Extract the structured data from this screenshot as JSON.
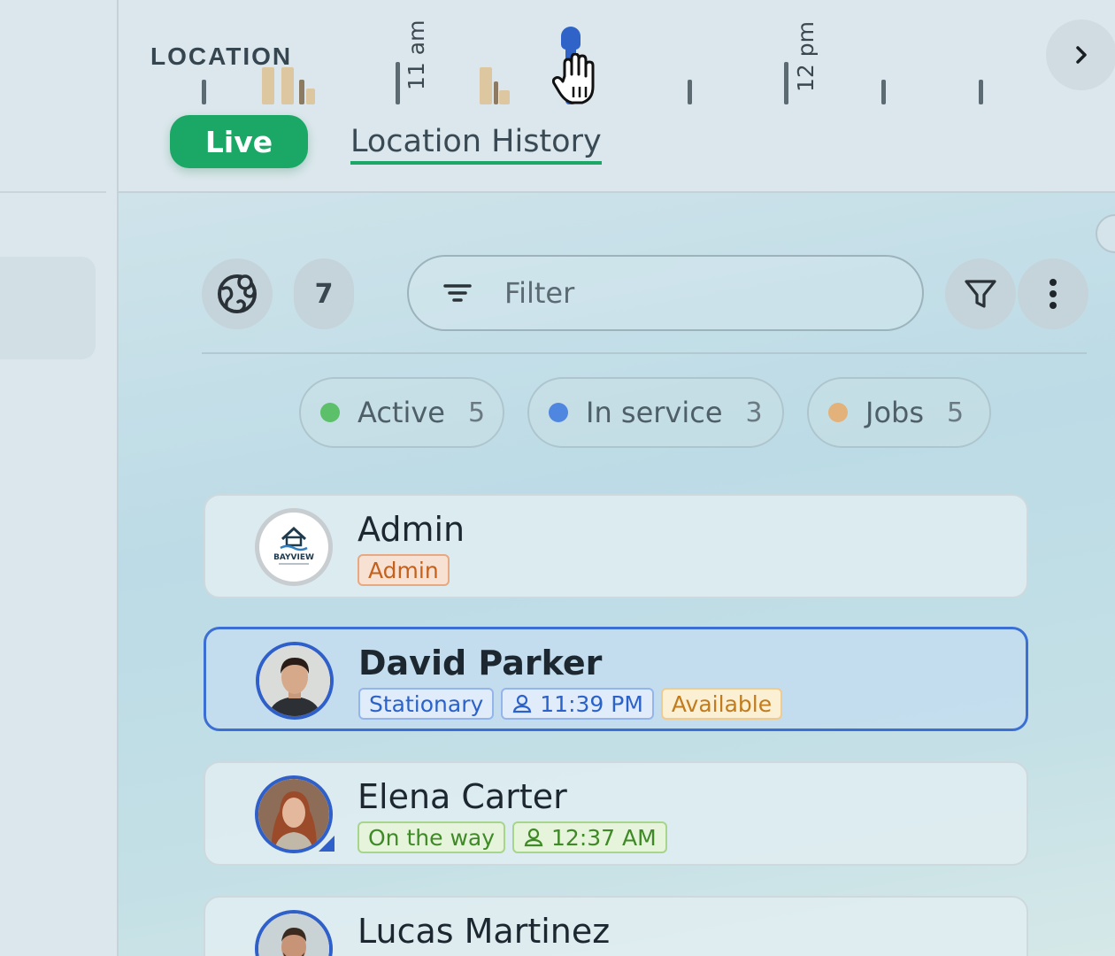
{
  "header": {
    "location_label": "LOCATION",
    "hour_labels": [
      "11 am",
      "12 pm"
    ],
    "tabs": {
      "live": "Live",
      "history": "Location History"
    }
  },
  "toolbar": {
    "count": "7",
    "filter_placeholder": "Filter"
  },
  "chips": [
    {
      "label": "Active",
      "count": "5",
      "color": "#5cbf6a"
    },
    {
      "label": "In service",
      "count": "3",
      "color": "#4f86e0"
    },
    {
      "label": "Jobs",
      "count": "5",
      "color": "#e2b27a"
    }
  ],
  "users": [
    {
      "name": "Admin",
      "avatar": "bayview-logo",
      "tags": [
        {
          "text": "Admin",
          "style": "orange"
        }
      ]
    },
    {
      "name": "David Parker",
      "avatar": "photo",
      "selected": true,
      "tags": [
        {
          "text": "Stationary",
          "style": "blue"
        },
        {
          "text": "11:39 PM",
          "style": "blue",
          "icon": "person-pin-icon"
        },
        {
          "text": "Available",
          "style": "yellow"
        }
      ]
    },
    {
      "name": "Elena Carter",
      "avatar": "photo",
      "tags": [
        {
          "text": "On the way",
          "style": "green"
        },
        {
          "text": "12:37 AM",
          "style": "green",
          "icon": "person-pin-icon"
        }
      ]
    },
    {
      "name": "Lucas Martinez",
      "avatar": "photo",
      "tags": []
    }
  ],
  "logo_text": "BAYVIEW"
}
